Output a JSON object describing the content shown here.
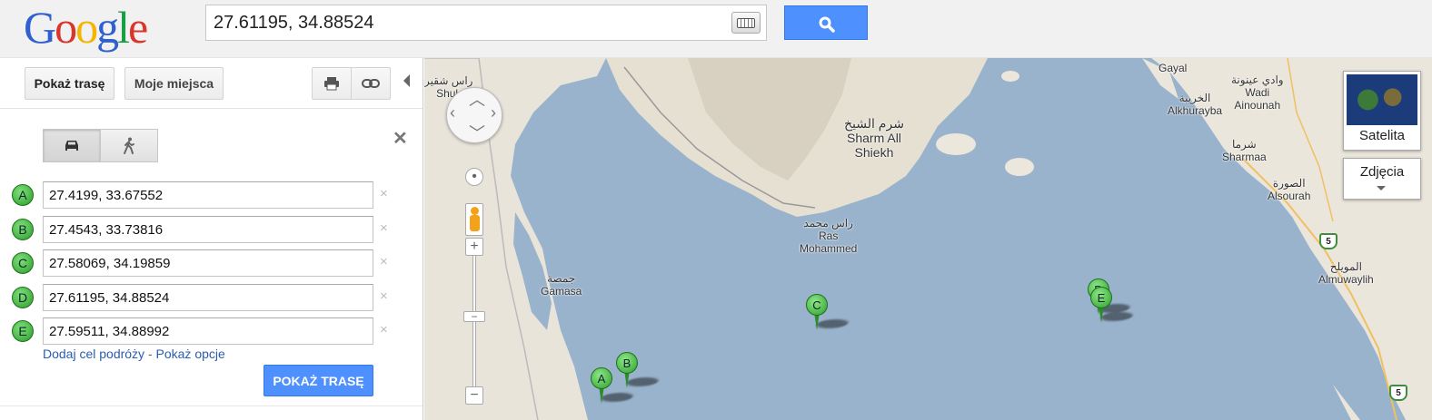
{
  "logo": {
    "text": "Google"
  },
  "search": {
    "value": "27.61195, 34.88524"
  },
  "toolbar": {
    "route_label": "Pokaż trasę",
    "places_label": "Moje miejsca"
  },
  "waypoints": [
    {
      "letter": "A",
      "value": "27.4199, 33.67552"
    },
    {
      "letter": "B",
      "value": "27.4543, 33.73816"
    },
    {
      "letter": "C",
      "value": "27.58069, 34.19859"
    },
    {
      "letter": "D",
      "value": "27.61195, 34.88524"
    },
    {
      "letter": "E",
      "value": "27.59511, 34.88992"
    }
  ],
  "links": {
    "add_destination": "Dodaj cel podróży",
    "separator": "-",
    "show_options": "Pokaż opcje"
  },
  "go_button": "POKAŻ TRASĘ",
  "remove_symbol": "×",
  "close_symbol": "✕",
  "map": {
    "satellite_label": "Satelita",
    "photos_label": "Zdjęcia",
    "zoom_in": "+",
    "zoom_out": "−",
    "labels": {
      "ras_shukeir_ar": "راس شقير",
      "ras_shukeir": "Shuk",
      "sharm_ar": "شرم الشيخ",
      "sharm1": "Sharm All",
      "sharm2": "Shiekh",
      "ras_mohammed_ar": "راس محمد",
      "ras_mohammed1": "Ras",
      "ras_mohammed2": "Mohammed",
      "gamasa_ar": "جمصة",
      "gamasa": "Gamasa",
      "gayal": "Gayal",
      "khuraybah_ar": "الخريبة",
      "khuraybah": "Alkhurayba",
      "wadi_ar": "وادي عينونة",
      "wadi1": "Wadi",
      "wadi2": "Ainounah",
      "sharmaa_ar": "شرما",
      "sharmaa": "Sharmaa",
      "sourah_ar": "الصورة",
      "sourah": "Alsourah",
      "muwaylih_ar": "المويلح",
      "muwaylih": "Almuwaylih",
      "shield1": "5",
      "shield2": "5"
    },
    "pins": [
      "A",
      "B",
      "C",
      "D",
      "E"
    ]
  },
  "colors": {
    "sea": "#99b3cc",
    "land": "#ece7dd",
    "accent": "#4d90fe",
    "marker": "#3fae3c"
  }
}
